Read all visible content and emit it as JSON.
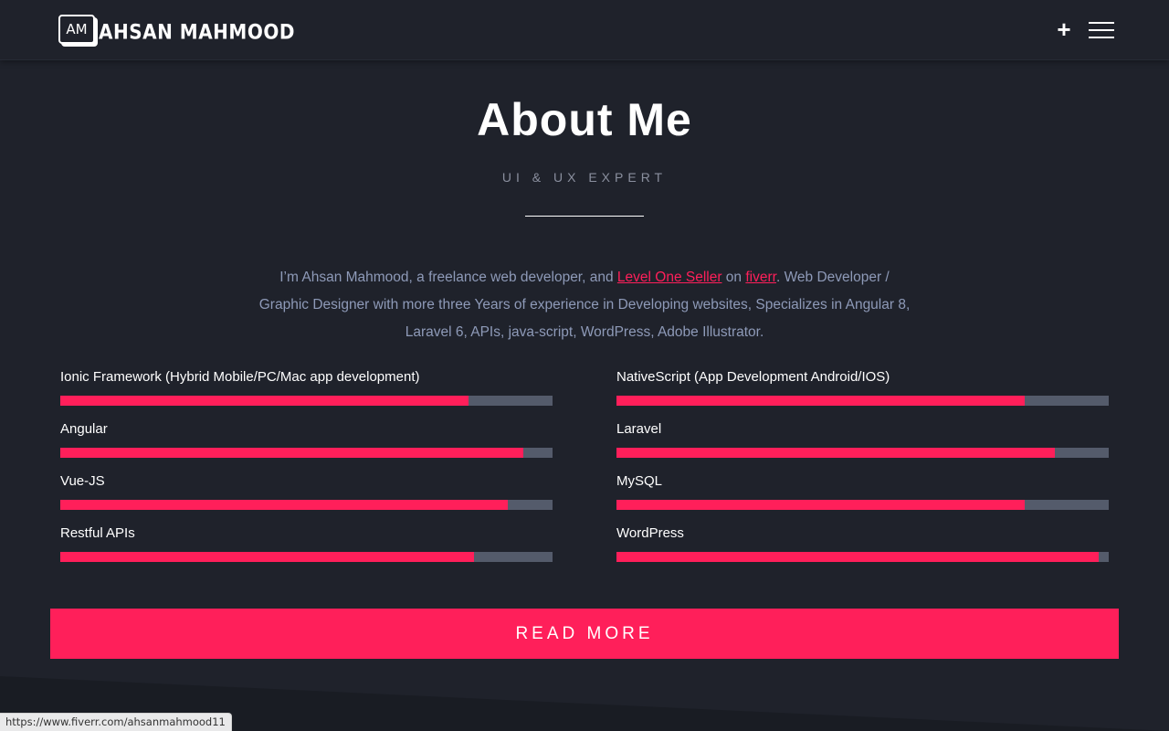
{
  "header": {
    "logo_badge": "AM",
    "logo_text": "AHSAN MAHMOOD",
    "plus_label": "+"
  },
  "about": {
    "title": "About Me",
    "subtitle": "UI & UX EXPERT",
    "bio_prefix": "I’m Ahsan Mahmood, a freelance web developer, and ",
    "link_level": "Level One Seller",
    "bio_mid": " on ",
    "link_fiverr": "fiverr",
    "bio_suffix": ". Web Developer / Graphic Designer with more three Years of experience in Developing websites, Specializes in Angular 8, Laravel 6, APIs, java-script, WordPress, Adobe Illustrator."
  },
  "skills": [
    {
      "label": "Ionic Framework (Hybrid Mobile/PC/Mac app development)",
      "percent": 83
    },
    {
      "label": "NativeScript (App Development Android/IOS)",
      "percent": 83
    },
    {
      "label": "Angular",
      "percent": 94
    },
    {
      "label": "Laravel",
      "percent": 89
    },
    {
      "label": "Vue-JS",
      "percent": 91
    },
    {
      "label": "MySQL",
      "percent": 83
    },
    {
      "label": "Restful APIs",
      "percent": 84
    },
    {
      "label": "WordPress",
      "percent": 98
    }
  ],
  "cta": {
    "read_more": "READ MORE"
  },
  "status_bar": {
    "url": "https://www.fiverr.com/ahsanmahmood11"
  },
  "colors": {
    "accent": "#ff1f5a",
    "background": "#1f222b",
    "track": "#545b6b"
  }
}
